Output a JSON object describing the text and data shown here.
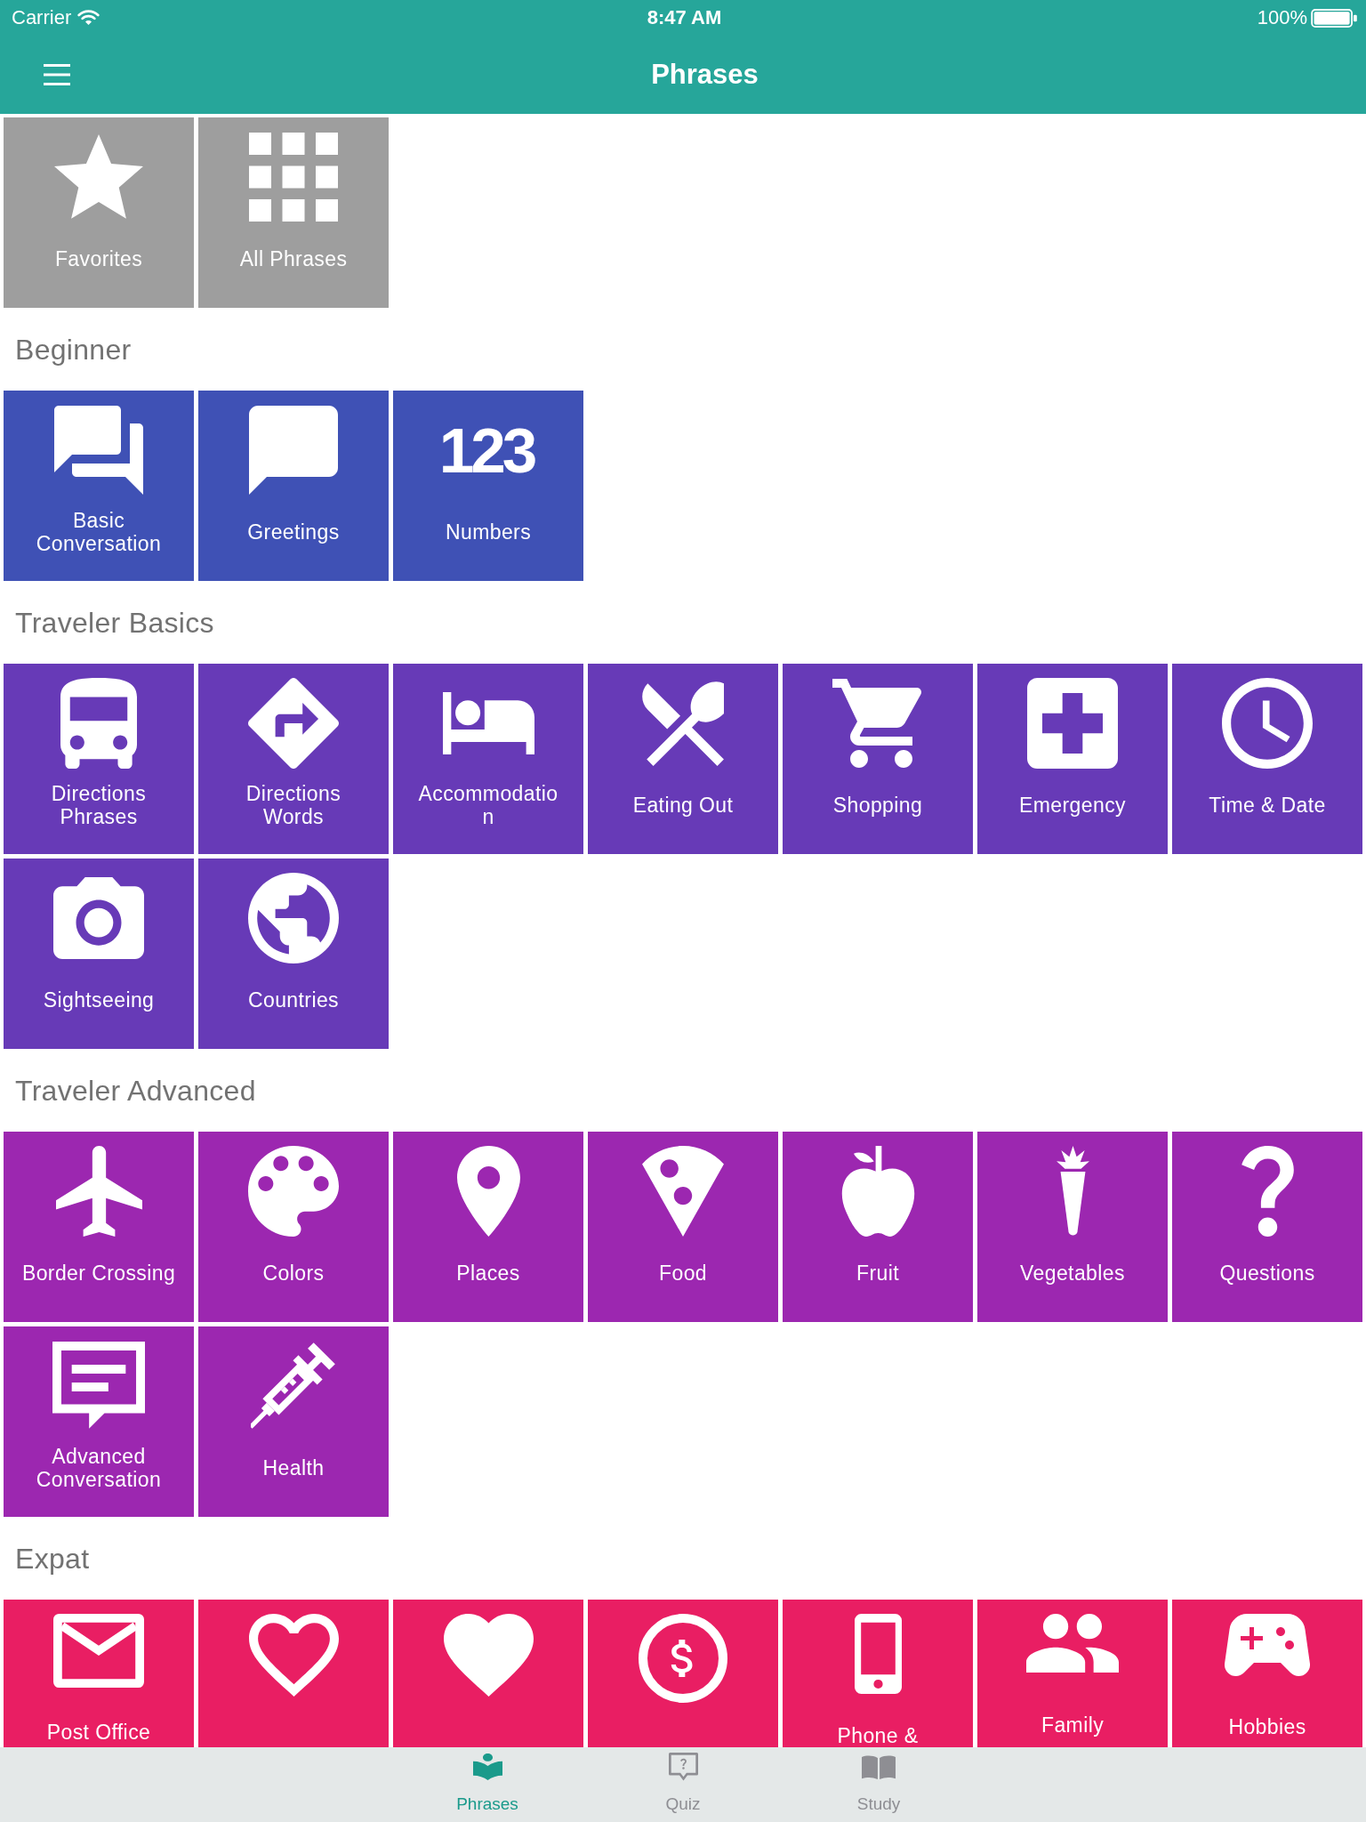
{
  "status_bar": {
    "carrier": "Carrier",
    "time": "8:47 AM",
    "battery": "100%"
  },
  "nav_bar": {
    "title": "Phrases"
  },
  "sections": [
    {
      "color": "#9e9e9e",
      "tiles": [
        {
          "label": "Favorites",
          "kind": "star"
        },
        {
          "label": "All Phrases",
          "kind": "grid"
        }
      ]
    },
    {
      "heading": "Beginner",
      "color": "#3f51b5",
      "tiles": [
        {
          "label": "Basic Conversation",
          "kind": "chats"
        },
        {
          "label": "Greetings",
          "kind": "chat"
        },
        {
          "label": "Numbers",
          "kind": "digits",
          "icon_text": "123"
        }
      ]
    },
    {
      "heading": "Traveler Basics",
      "color": "#673ab7",
      "tiles": [
        {
          "label": "Directions Phrases",
          "kind": "bus"
        },
        {
          "label": "Directions Words",
          "kind": "road-sign"
        },
        {
          "label": "Accommodatio\nn",
          "kind": "bed"
        },
        {
          "label": "Eating Out",
          "kind": "utensils"
        },
        {
          "label": "Shopping",
          "kind": "cart"
        },
        {
          "label": "Emergency",
          "kind": "plus-square"
        },
        {
          "label": "Time & Date",
          "kind": "clock"
        },
        {
          "label": "Sightseeing",
          "kind": "camera"
        },
        {
          "label": "Countries",
          "kind": "globe"
        }
      ]
    },
    {
      "heading": "Traveler Advanced",
      "color": "#9c27b0",
      "tiles": [
        {
          "label": "Border Crossing",
          "kind": "plane"
        },
        {
          "label": "Colors",
          "kind": "palette"
        },
        {
          "label": "Places",
          "kind": "pin"
        },
        {
          "label": "Food",
          "kind": "pizza"
        },
        {
          "label": "Fruit",
          "kind": "apple"
        },
        {
          "label": "Vegetables",
          "kind": "carrot"
        },
        {
          "label": "Questions",
          "kind": "question"
        },
        {
          "label": "Advanced Conversation",
          "kind": "message"
        },
        {
          "label": "Health",
          "kind": "syringe"
        }
      ]
    },
    {
      "heading": "Expat",
      "color": "#e91e63",
      "tiles": [
        {
          "label": "Post Office",
          "kind": "envelope"
        },
        {
          "kind": "heart-outline"
        },
        {
          "kind": "heart"
        },
        {
          "kind": "dollar"
        },
        {
          "label": "Phone &",
          "kind": "phone"
        },
        {
          "label": "Family",
          "kind": "people"
        },
        {
          "label": "Hobbies",
          "kind": "gamepad"
        }
      ]
    }
  ],
  "tab_bar": [
    {
      "label": "Phrases",
      "kind": "reader",
      "selected": true
    },
    {
      "label": "Quiz",
      "kind": "quiz",
      "selected": false
    },
    {
      "label": "Study",
      "kind": "book",
      "selected": false
    }
  ]
}
